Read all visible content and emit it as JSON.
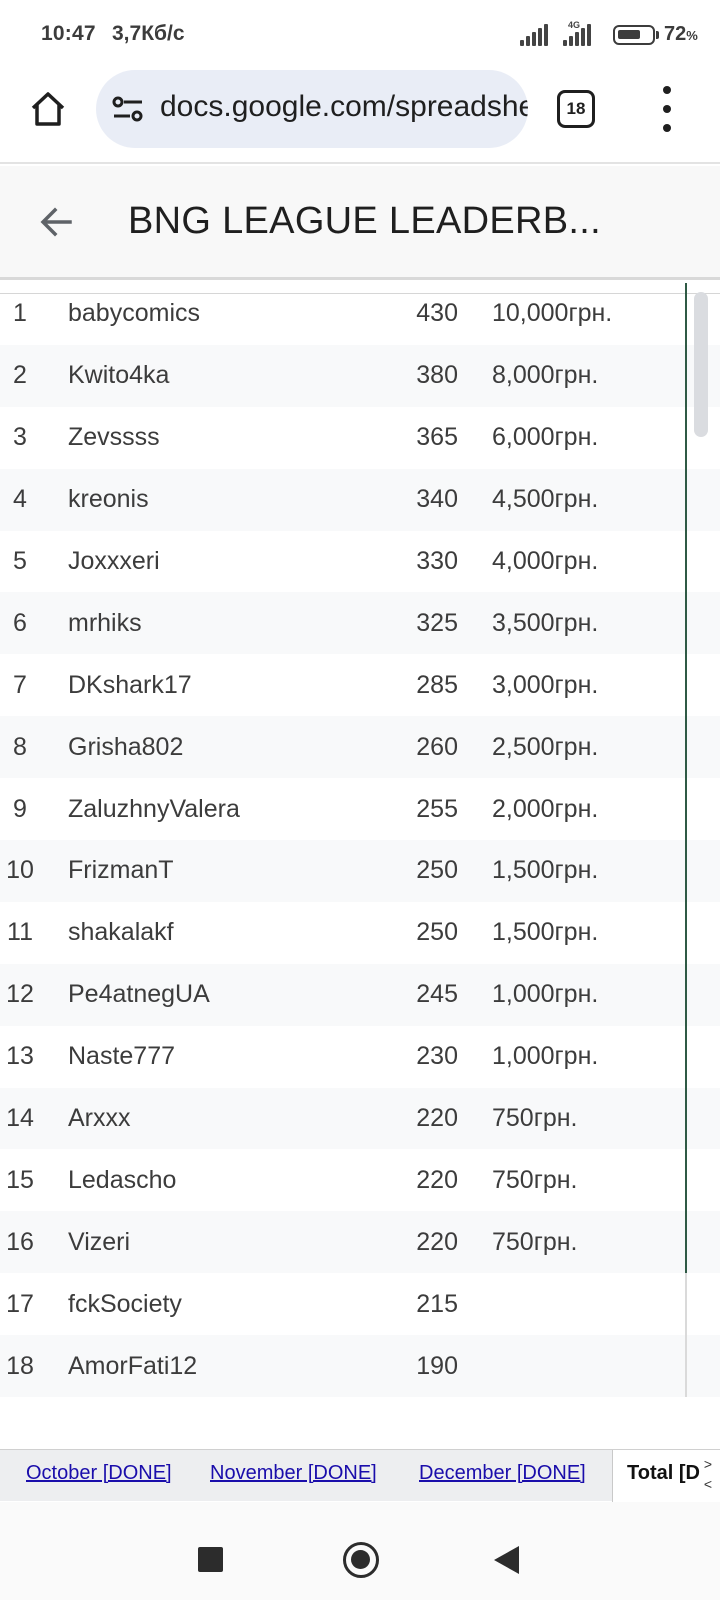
{
  "status_bar": {
    "time": "10:47",
    "speed": "3,7Кб/с",
    "network": "4G",
    "battery_level": 72,
    "battery_label": "72",
    "battery_unit": "%"
  },
  "browser": {
    "url": "docs.google.com/spreadsheets",
    "tab_count": "18",
    "home_icon": "home-icon",
    "site_settings_icon": "tune-icon",
    "menu_icon": "more-vert-icon"
  },
  "sheet": {
    "title": "BNG LEAGUE LEADERB...",
    "back_icon": "arrow-back-icon",
    "rows": [
      {
        "rank": "1",
        "name": "babycomics",
        "points": "430",
        "prize": "10,000грн."
      },
      {
        "rank": "2",
        "name": "Kwito4ka",
        "points": "380",
        "prize": "8,000грн."
      },
      {
        "rank": "3",
        "name": "Zevssss",
        "points": "365",
        "prize": "6,000грн."
      },
      {
        "rank": "4",
        "name": "kreonis",
        "points": "340",
        "prize": "4,500грн."
      },
      {
        "rank": "5",
        "name": "Joxxxeri",
        "points": "330",
        "prize": "4,000грн."
      },
      {
        "rank": "6",
        "name": "mrhiks",
        "points": "325",
        "prize": "3,500грн."
      },
      {
        "rank": "7",
        "name": "DKshark17",
        "points": "285",
        "prize": "3,000грн."
      },
      {
        "rank": "8",
        "name": "Grisha802",
        "points": "260",
        "prize": "2,500грн."
      },
      {
        "rank": "9",
        "name": "ZaluzhnyValera",
        "points": "255",
        "prize": "2,000грн."
      },
      {
        "rank": "10",
        "name": "FrizmanT",
        "points": "250",
        "prize": "1,500грн."
      },
      {
        "rank": "11",
        "name": "shakalakf",
        "points": "250",
        "prize": "1,500грн."
      },
      {
        "rank": "12",
        "name": "Pe4atnegUA",
        "points": "245",
        "prize": "1,000грн."
      },
      {
        "rank": "13",
        "name": "Naste777",
        "points": "230",
        "prize": "1,000грн."
      },
      {
        "rank": "14",
        "name": "Arxxx",
        "points": "220",
        "prize": "750грн."
      },
      {
        "rank": "15",
        "name": "Ledascho",
        "points": "220",
        "prize": "750грн."
      },
      {
        "rank": "16",
        "name": "Vizeri",
        "points": "220",
        "prize": "750грн."
      },
      {
        "rank": "17",
        "name": "fckSociety",
        "points": "215",
        "prize": ""
      },
      {
        "rank": "18",
        "name": "AmorFati12",
        "points": "190",
        "prize": ""
      }
    ],
    "tabs": [
      {
        "label": "October [DONE]",
        "active": false
      },
      {
        "label": "November [DONE]",
        "active": false
      },
      {
        "label": "December [DONE]",
        "active": false
      },
      {
        "label": "Total [D",
        "active": true
      }
    ],
    "tab_nav_next": ">",
    "tab_nav_prev": "<"
  },
  "colors": {
    "prize_border": "#2f5a45",
    "tab_link": "#1a0dab",
    "alt_row": "#f8f9fa"
  }
}
